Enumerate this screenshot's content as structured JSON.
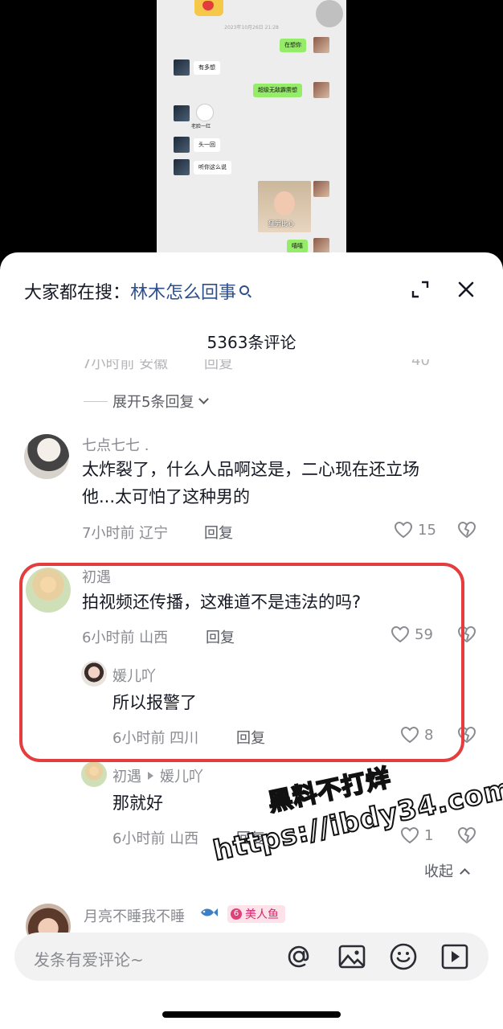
{
  "video": {
    "chat_time": "2023年10月26日 21:28",
    "messages": [
      {
        "side": "right",
        "text": "在想你"
      },
      {
        "side": "left",
        "text": "有多想"
      },
      {
        "side": "right",
        "text": "超级无敌霹雳想"
      },
      {
        "side": "left",
        "text": "老脸一红"
      },
      {
        "side": "left",
        "text": "头一回"
      },
      {
        "side": "left",
        "text": "听你这么说"
      },
      {
        "side": "right",
        "text": "猛男比心"
      },
      {
        "side": "right",
        "text": "嘻嘻"
      }
    ]
  },
  "header": {
    "search_prefix": "大家都在搜：",
    "search_term": "林木怎么回事",
    "comment_count": "5363条评论"
  },
  "ghost_row": {
    "meta": "7小时前 安徽",
    "reply": "回复",
    "likes": "40"
  },
  "expand": {
    "label": "展开5条回复"
  },
  "comments": [
    {
      "name": "七点七七 .",
      "text_line1": "太炸裂了，什么人品啊这是，二心现在还立场",
      "text_line2": "他...太可怕了这种男的",
      "meta": "7小时前 辽宁",
      "reply": "回复",
      "likes": "15"
    },
    {
      "name": "初遇",
      "text": "拍视频还传播，这难道不是违法的吗?",
      "meta": "6小时前 山西",
      "reply": "回复",
      "likes": "59",
      "replies": [
        {
          "name": "媛儿吖",
          "text": "所以报警了",
          "meta": "6小时前 四川",
          "reply": "回复",
          "likes": "8"
        },
        {
          "name": "初遇",
          "reply_to": "媛儿吖",
          "text": "那就好",
          "meta": "6小时前 山西",
          "reply": "回复",
          "likes": "1"
        }
      ]
    },
    {
      "name": "月亮不睡我不睡",
      "badge_level": "6",
      "badge_text": "美人鱼"
    }
  ],
  "collapse": {
    "label": "收起"
  },
  "input": {
    "placeholder": "发条有爱评论~"
  },
  "watermark": {
    "line1": "黑料不打烊",
    "line2": "https://ibdy34.com"
  },
  "colors": {
    "accent_link": "#2e4f8e",
    "highlight_border": "#e43d3d",
    "wechat_green": "#95ec69"
  }
}
